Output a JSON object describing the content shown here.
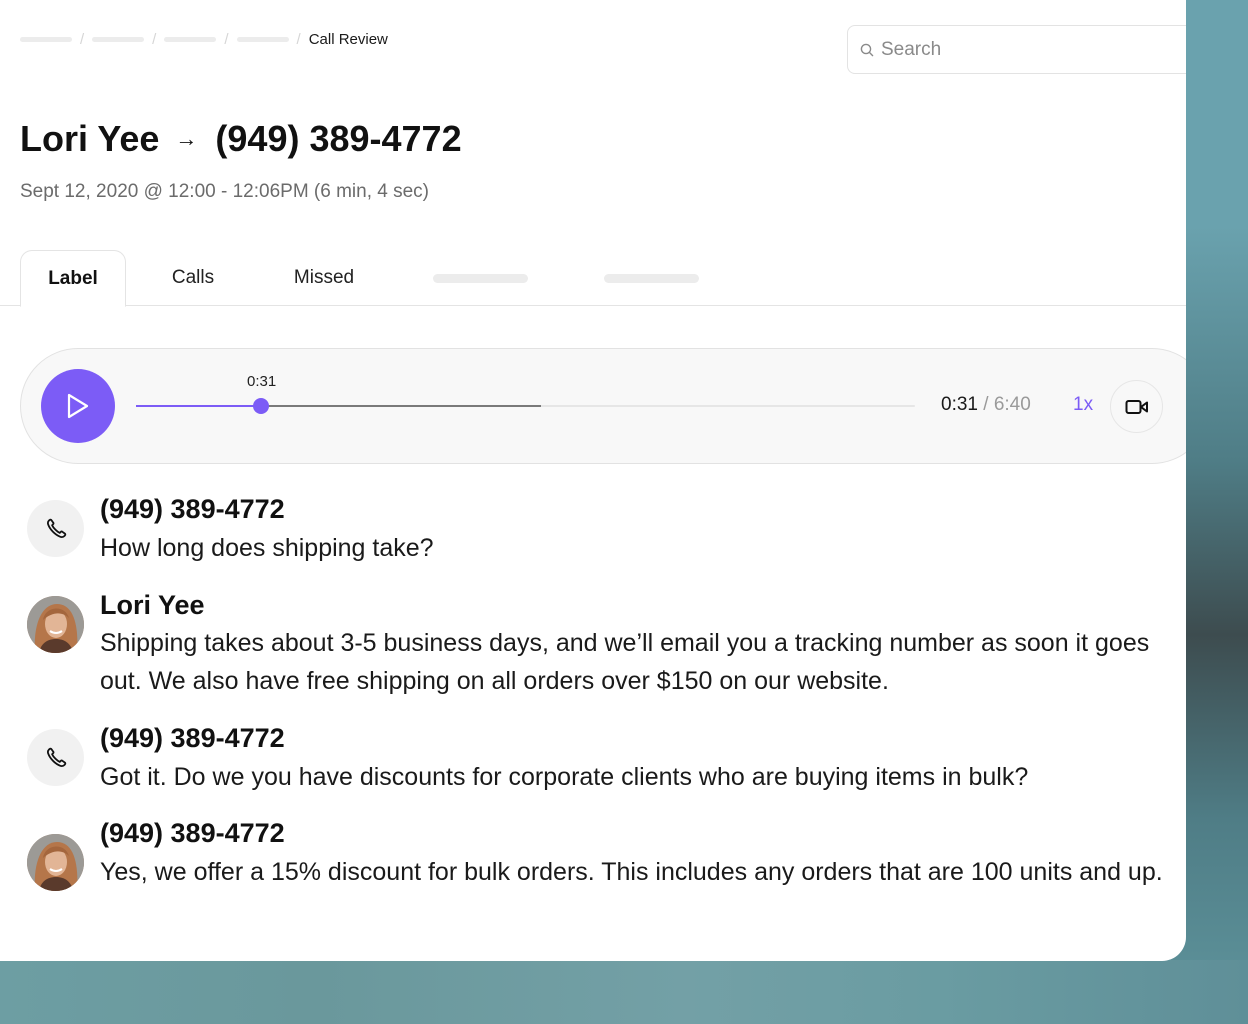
{
  "breadcrumb": {
    "placeholder_count": 4,
    "separator": "/",
    "current": "Call Review"
  },
  "search": {
    "placeholder": "Search",
    "value": "",
    "icon": "search-icon"
  },
  "header": {
    "caller": "Lori Yee",
    "arrow_icon": "arrow-right-icon",
    "arrow": "→",
    "callee": "(949) 389-4772",
    "subtitle": "Sept 12, 2020 @ 12:00 - 12:06PM (6 min, 4 sec)"
  },
  "tabs": [
    {
      "label": "Label",
      "active": true
    },
    {
      "label": "Calls",
      "active": false
    },
    {
      "label": "Missed",
      "active": false
    }
  ],
  "tab_placeholders": 2,
  "player": {
    "play_icon": "play-icon",
    "marker_time": "0:31",
    "current_time": "0:31",
    "separator": "/",
    "total_time": "6:40",
    "speed": "1x",
    "video_icon": "video-camera-icon",
    "played_fraction": 0.16,
    "buffered_fraction": 0.52,
    "accent_color": "#7c5cf6"
  },
  "transcript": [
    {
      "speaker": "(949) 389-4772",
      "avatar": "phone-icon",
      "message": "How long does shipping take?"
    },
    {
      "speaker": "Lori Yee",
      "avatar": "photo",
      "message": "Shipping takes about 3-5 business days, and we’ll email you a tracking number as soon it goes out. We also have free shipping on all orders over $150 on our website."
    },
    {
      "speaker": "(949) 389-4772",
      "avatar": "phone-icon",
      "message": "Got it. Do we you have discounts for corporate clients who are buying items in bulk?"
    },
    {
      "speaker": "(949) 389-4772",
      "avatar": "photo",
      "message": "Yes, we offer a 15% discount for bulk orders. This includes any orders that are 100 units and up."
    }
  ]
}
